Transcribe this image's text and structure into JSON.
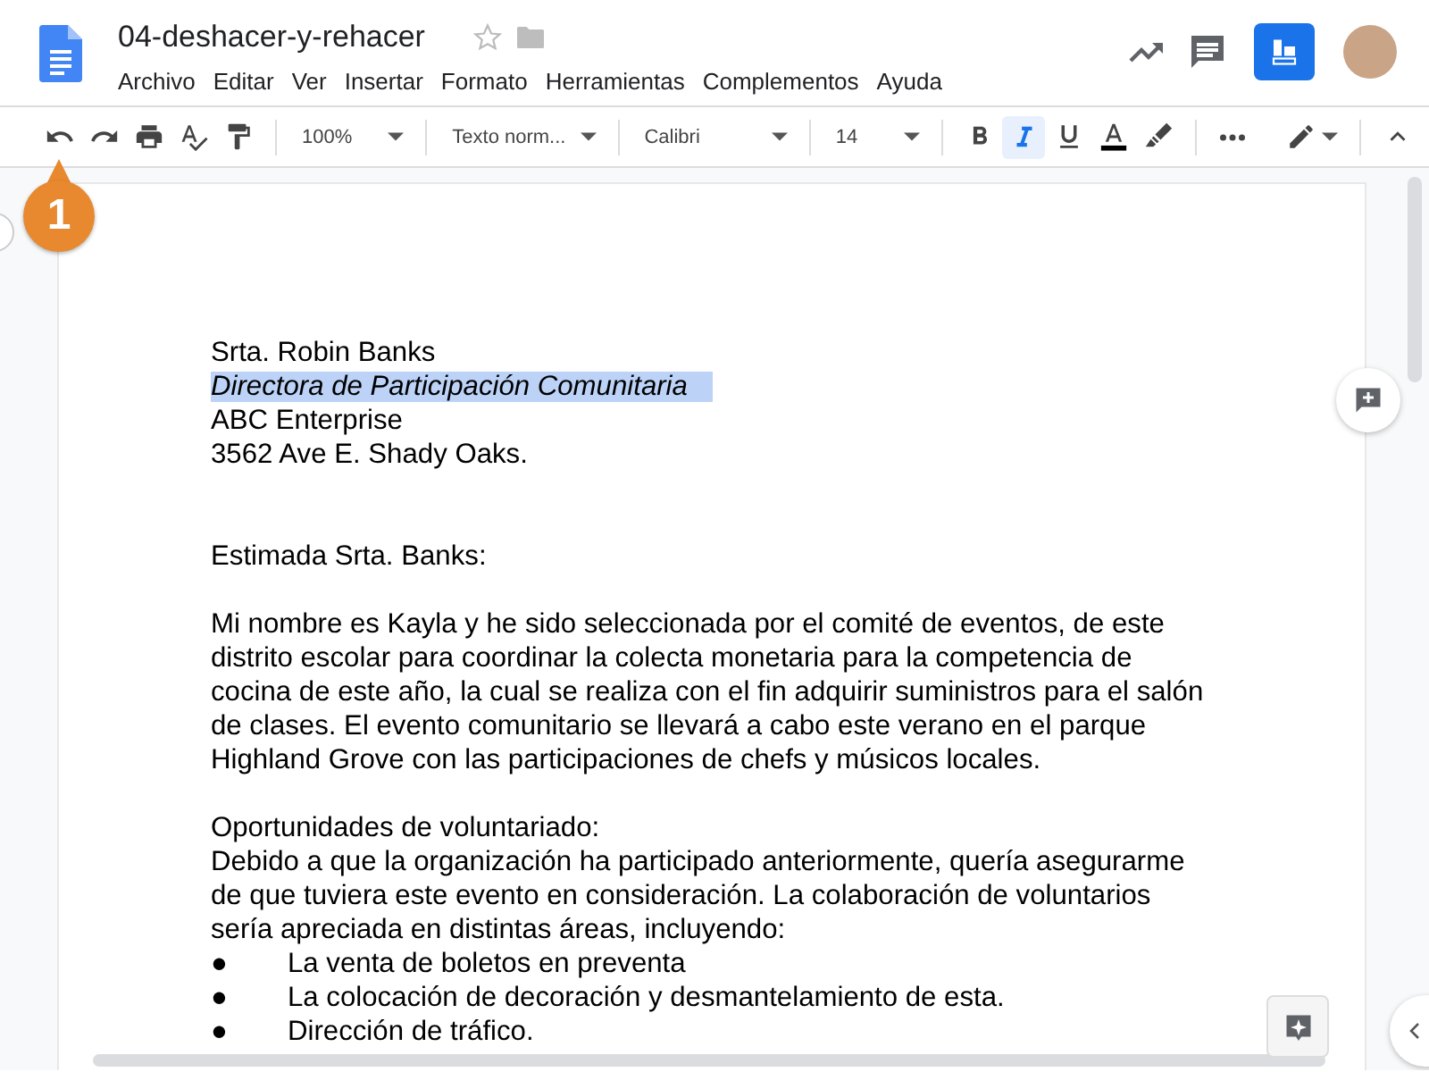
{
  "document": {
    "title": "04-deshacer-y-rehacer",
    "starred": false
  },
  "menu": [
    "Archivo",
    "Editar",
    "Ver",
    "Insertar",
    "Formato",
    "Herramientas",
    "Complementos",
    "Ayuda"
  ],
  "toolbar": {
    "zoom": "100%",
    "style": "Texto norm...",
    "font": "Calibri",
    "size": "14",
    "bold": false,
    "italic": true,
    "underline": false
  },
  "callout": {
    "number": "1"
  },
  "body": [
    {
      "kind": "line",
      "text": "Srta. Robin Banks",
      "italic": false,
      "selected": false
    },
    {
      "kind": "line",
      "text": "Directora de Participación Comunitaria",
      "italic": true,
      "selected": true
    },
    {
      "kind": "line",
      "text": "ABC Enterprise",
      "italic": false,
      "selected": false
    },
    {
      "kind": "line",
      "text": "3562 Ave E. Shady Oaks.",
      "italic": false,
      "selected": false
    },
    {
      "kind": "blank"
    },
    {
      "kind": "blank"
    },
    {
      "kind": "line",
      "text": "Estimada Srta. Banks:",
      "italic": false,
      "selected": false
    },
    {
      "kind": "blank"
    },
    {
      "kind": "line",
      "text": "Mi nombre es Kayla y he sido seleccionada por el comité de eventos, de este distrito escolar para coordinar la colecta monetaria para la competencia de cocina de este año, la cual se realiza con el fin adquirir suministros para el salón de clases. El evento comunitario se llevará a cabo este verano en el parque Highland Grove con las participaciones de chefs y músicos locales.",
      "italic": false,
      "selected": false
    },
    {
      "kind": "blank"
    },
    {
      "kind": "line",
      "text": "Oportunidades de voluntariado:",
      "italic": false,
      "selected": false
    },
    {
      "kind": "line",
      "text": "Debido a que la organización ha participado anteriormente, quería asegurarme de que tuviera este evento en consideración. La colaboración de voluntarios sería apreciada en distintas áreas, incluyendo:",
      "italic": false,
      "selected": false
    },
    {
      "kind": "bullet",
      "marker": "●",
      "text": "La venta de boletos en preventa"
    },
    {
      "kind": "bullet",
      "marker": "●",
      "text": "La colocación de decoración y desmantelamiento de esta."
    },
    {
      "kind": "bullet",
      "marker": "●",
      "text": "Dirección de tráfico."
    }
  ]
}
